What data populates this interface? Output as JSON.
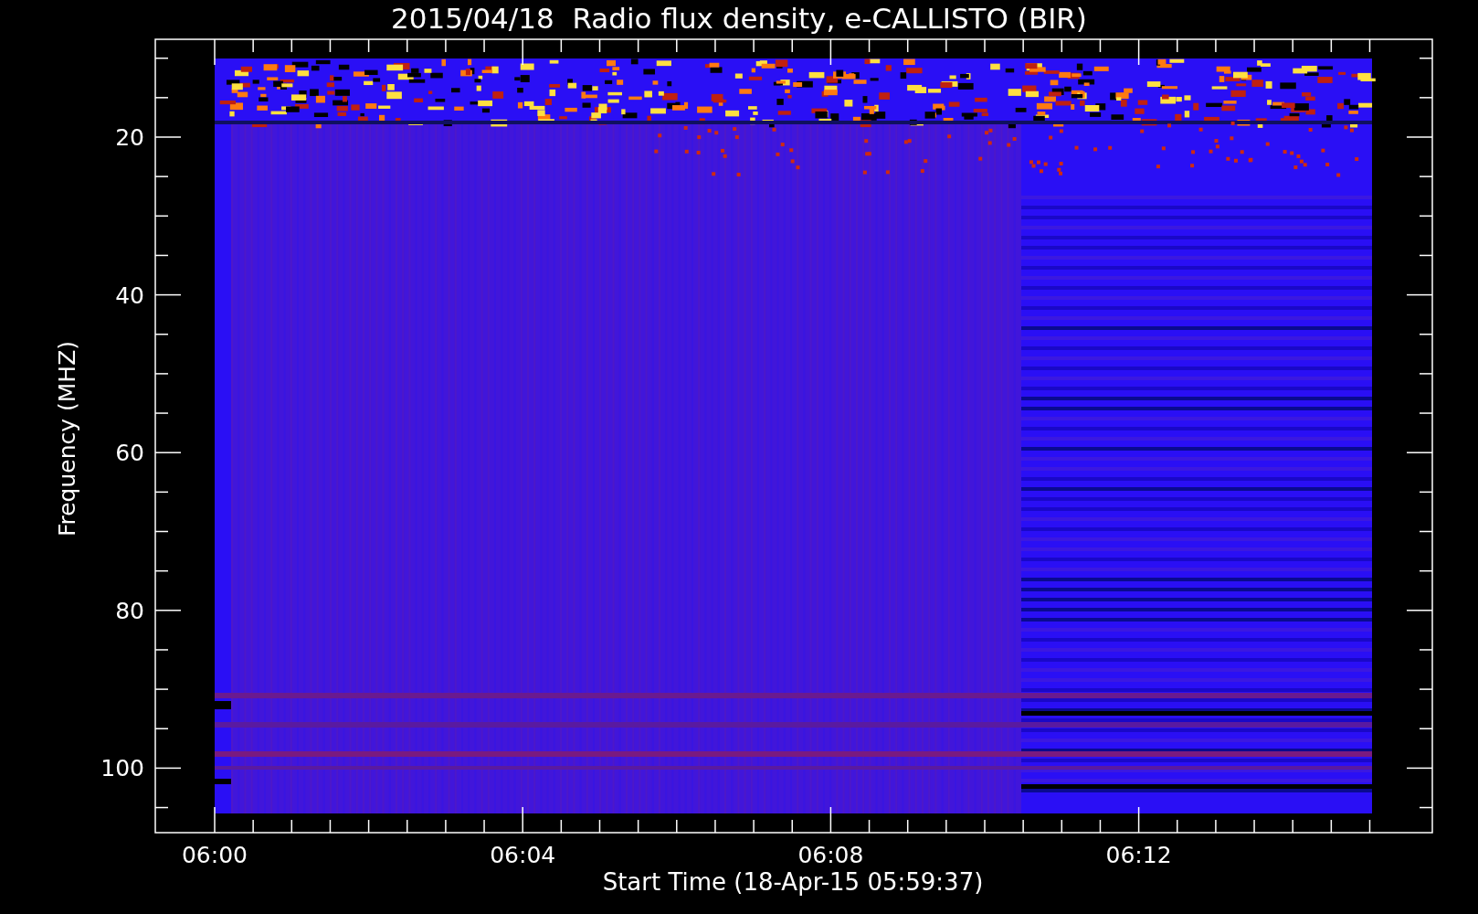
{
  "title": "2015/04/18  Radio flux density, e-CALLISTO (BIR)",
  "x_axis": {
    "label": "Start Time (18-Apr-15 05:59:37)",
    "ticks": [
      "06:00",
      "06:04",
      "06:08",
      "06:12"
    ]
  },
  "y_axis": {
    "label": "Frequency (MHZ)",
    "ticks": [
      "20",
      "40",
      "60",
      "80",
      "100"
    ]
  }
}
